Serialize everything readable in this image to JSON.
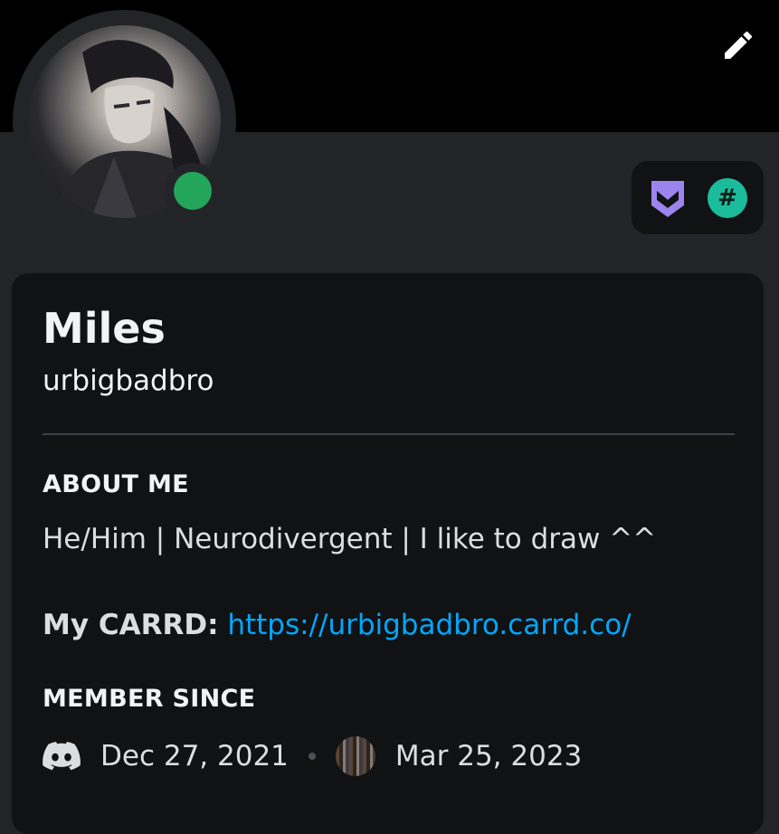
{
  "profile": {
    "display_name": "Miles",
    "username": "urbigbadbro",
    "status": "online",
    "status_color": "#23a55a"
  },
  "badges": [
    {
      "icon": "hypesquad-balance-icon",
      "color": "#9b84ee"
    },
    {
      "icon": "hashtag-icon",
      "glyph": "#",
      "color": "#1abc9c"
    }
  ],
  "about": {
    "title": "ABOUT ME",
    "text": "He/Him | Neurodivergent | I like to draw ^^",
    "carrd_label": "My CARRD:",
    "carrd_link": "https://urbigbadbro.carrd.co/"
  },
  "member_since": {
    "title": "MEMBER SINCE",
    "discord_date": "Dec 27, 2021",
    "server_date": "Mar 25, 2023"
  },
  "colors": {
    "banner": "#000000",
    "panel": "#232428",
    "card": "#111214",
    "link": "#00a8fc"
  }
}
